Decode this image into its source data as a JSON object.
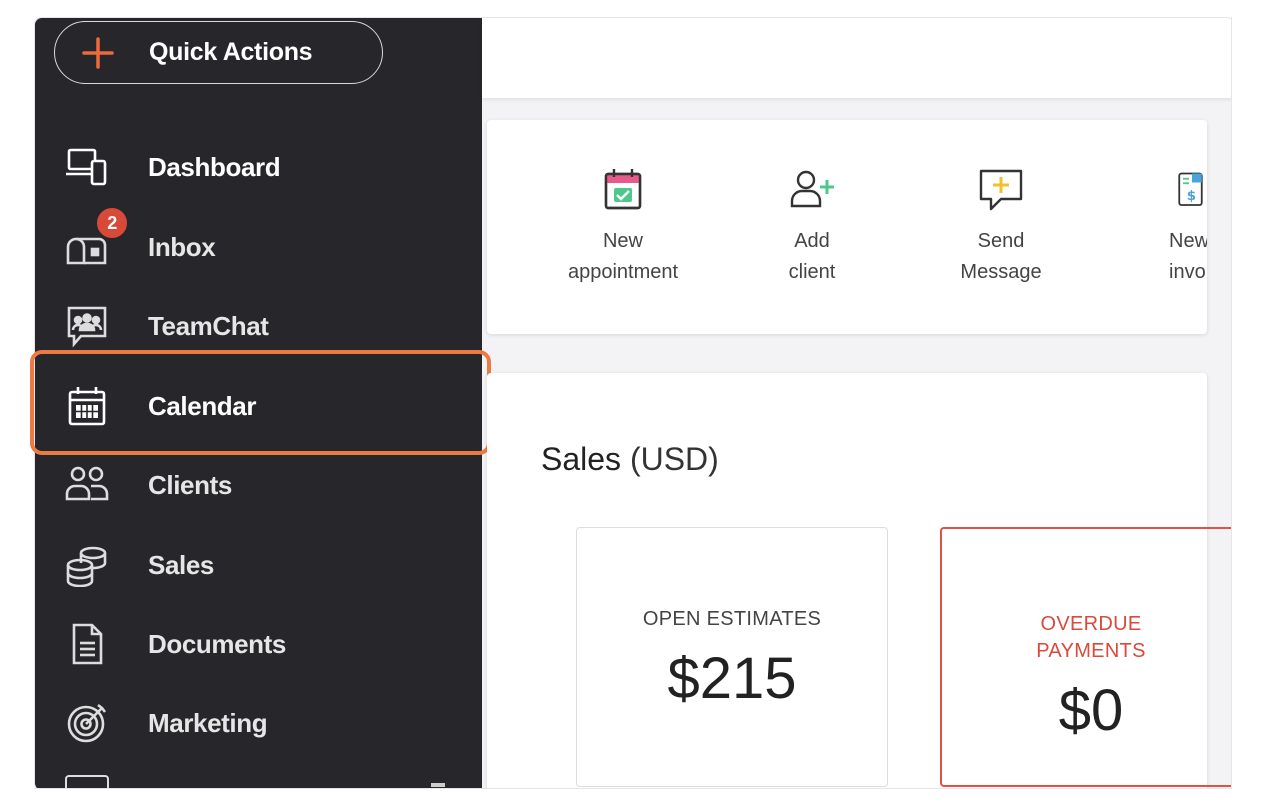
{
  "sidebar": {
    "quick_actions_label": "Quick Actions",
    "items": [
      {
        "label": "Dashboard",
        "icon": "dashboard-icon"
      },
      {
        "label": "Inbox",
        "icon": "inbox-icon",
        "badge": "2"
      },
      {
        "label": "TeamChat",
        "icon": "teamchat-icon"
      },
      {
        "label": "Calendar",
        "icon": "calendar-icon",
        "highlighted": true
      },
      {
        "label": "Clients",
        "icon": "clients-icon"
      },
      {
        "label": "Sales",
        "icon": "sales-icon"
      },
      {
        "label": "Documents",
        "icon": "documents-icon"
      },
      {
        "label": "Marketing",
        "icon": "marketing-icon"
      }
    ]
  },
  "quick_actions": [
    {
      "line1": "New",
      "line2": "appointment",
      "icon": "new-appointment-icon"
    },
    {
      "line1": "Add",
      "line2": "client",
      "icon": "add-client-icon"
    },
    {
      "line1": "Send",
      "line2": "Message",
      "icon": "send-message-icon"
    },
    {
      "line1": "New",
      "line2": "invoi",
      "icon": "new-invoice-icon"
    }
  ],
  "sales": {
    "title": "Sales",
    "unit": "(USD)",
    "cards": [
      {
        "label": "OPEN ESTIMATES",
        "value": "$215"
      },
      {
        "label_line1": "OVERDUE",
        "label_line2": "PAYMENTS",
        "value": "$0"
      }
    ]
  },
  "colors": {
    "sidebar_bg": "#27272b",
    "accent_orange": "#ec7a43",
    "alert_red": "#e0514a"
  }
}
